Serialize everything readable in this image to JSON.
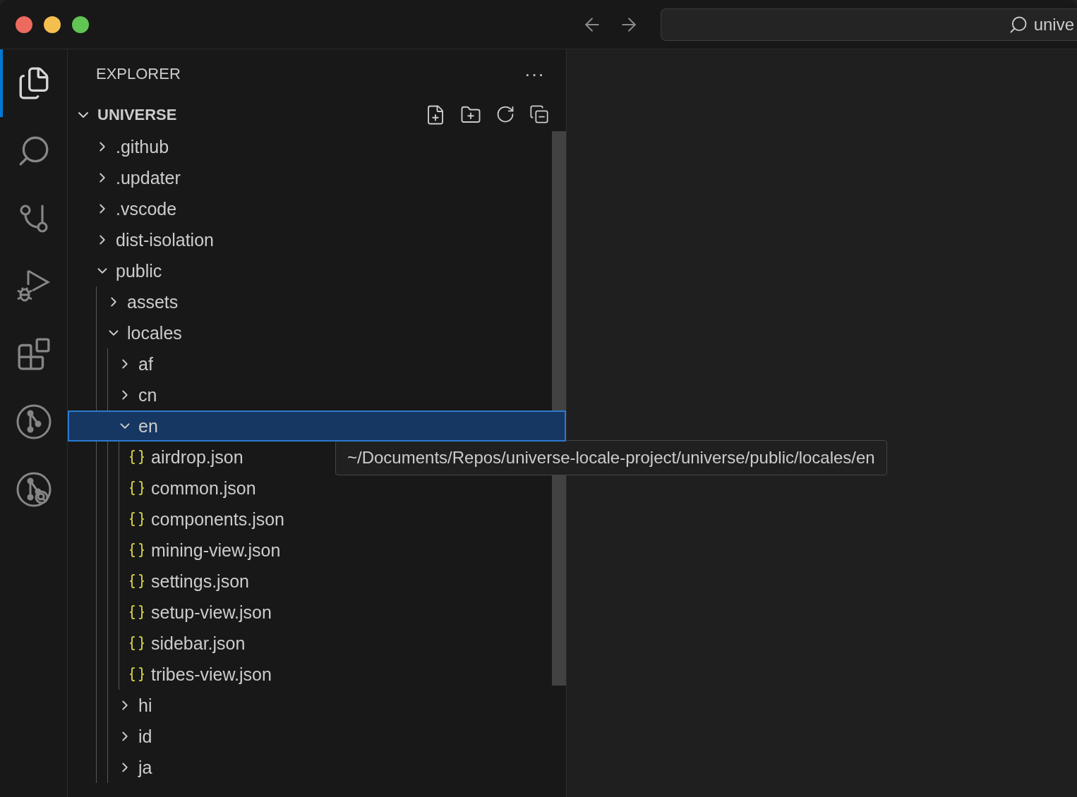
{
  "title_bar": {
    "search": {
      "value": "unive"
    }
  },
  "activity_bar": [
    {
      "kind": "files",
      "selected": true
    },
    {
      "kind": "search",
      "selected": false
    },
    {
      "kind": "source-control",
      "selected": false
    },
    {
      "kind": "run-debug",
      "selected": false
    },
    {
      "kind": "extensions",
      "selected": false
    },
    {
      "kind": "git-graph",
      "selected": false
    },
    {
      "kind": "git-inspect",
      "selected": false
    }
  ],
  "sidebar": {
    "title": "EXPLORER",
    "more": "···",
    "folder": {
      "name": "UNIVERSE",
      "expanded": true
    },
    "tree": [
      {
        "name": ".github",
        "kind": "folder",
        "expanded": false,
        "selected": false
      },
      {
        "name": ".updater",
        "kind": "folder",
        "expanded": false,
        "selected": false
      },
      {
        "name": ".vscode",
        "kind": "folder",
        "expanded": false,
        "selected": false
      },
      {
        "name": "dist-isolation",
        "kind": "folder",
        "expanded": false,
        "selected": false
      },
      {
        "name": "public",
        "kind": "folder",
        "expanded": true,
        "selected": false,
        "children": [
          {
            "name": "assets",
            "kind": "folder",
            "expanded": false,
            "selected": false
          },
          {
            "name": "locales",
            "kind": "folder",
            "expanded": true,
            "selected": false,
            "children": [
              {
                "name": "af",
                "kind": "folder",
                "expanded": false,
                "selected": false
              },
              {
                "name": "cn",
                "kind": "folder",
                "expanded": false,
                "selected": false
              },
              {
                "name": "en",
                "kind": "folder",
                "expanded": true,
                "selected": true,
                "children": [
                  {
                    "name": "airdrop.json",
                    "kind": "json",
                    "selected": false
                  },
                  {
                    "name": "common.json",
                    "kind": "json",
                    "selected": false
                  },
                  {
                    "name": "components.json",
                    "kind": "json",
                    "selected": false
                  },
                  {
                    "name": "mining-view.json",
                    "kind": "json",
                    "selected": false
                  },
                  {
                    "name": "settings.json",
                    "kind": "json",
                    "selected": false
                  },
                  {
                    "name": "setup-view.json",
                    "kind": "json",
                    "selected": false
                  },
                  {
                    "name": "sidebar.json",
                    "kind": "json",
                    "selected": false
                  },
                  {
                    "name": "tribes-view.json",
                    "kind": "json",
                    "selected": false
                  }
                ]
              },
              {
                "name": "hi",
                "kind": "folder",
                "expanded": false,
                "selected": false
              },
              {
                "name": "id",
                "kind": "folder",
                "expanded": false,
                "selected": false
              },
              {
                "name": "ja",
                "kind": "folder",
                "expanded": false,
                "selected": false
              }
            ]
          }
        ]
      }
    ]
  },
  "tooltip": "~/Documents/Repos/universe-locale-project/universe/public/locales/en"
}
